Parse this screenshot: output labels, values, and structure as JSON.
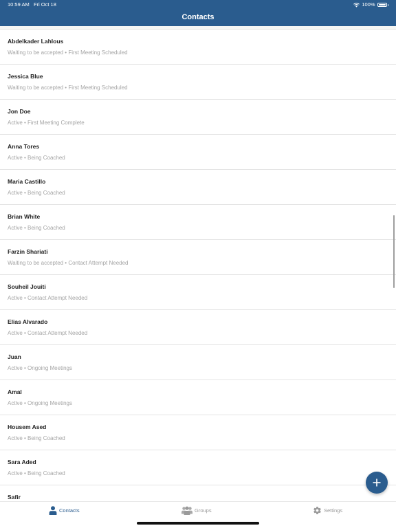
{
  "status_bar": {
    "time": "10:59 AM",
    "date": "Fri Oct 18",
    "battery": "100%"
  },
  "header": {
    "title": "Contacts"
  },
  "contacts": [
    {
      "name": "Abdelkader Lahlous",
      "status": "Waiting to be accepted • First Meeting Scheduled"
    },
    {
      "name": "Jessica Blue",
      "status": "Waiting to be accepted • First Meeting Scheduled"
    },
    {
      "name": "Jon Doe",
      "status": "Active • First Meeting Complete"
    },
    {
      "name": "Anna Tores",
      "status": "Active • Being Coached"
    },
    {
      "name": "Maria Castillo",
      "status": "Active • Being Coached"
    },
    {
      "name": "Brian White",
      "status": "Active • Being Coached"
    },
    {
      "name": "Farzin Shariati",
      "status": "Waiting to be accepted • Contact Attempt Needed"
    },
    {
      "name": "Souheil Jouiti",
      "status": "Active • Contact Attempt Needed"
    },
    {
      "name": "Elias Alvarado",
      "status": "Active • Contact Attempt Needed"
    },
    {
      "name": "Juan",
      "status": "Active • Ongoing Meetings"
    },
    {
      "name": "Amal",
      "status": "Active • Ongoing Meetings"
    },
    {
      "name": "Housem Ased",
      "status": "Active • Being Coached"
    },
    {
      "name": "Sara Aded",
      "status": "Active • Being Coached"
    },
    {
      "name": "Safir",
      "status": ""
    }
  ],
  "fab": {
    "icon": "plus-icon"
  },
  "tabbar": {
    "tabs": [
      {
        "label": "Contacts",
        "icon": "person-icon",
        "active": true
      },
      {
        "label": "Groups",
        "icon": "group-icon",
        "active": false
      },
      {
        "label": "Settings",
        "icon": "gear-icon",
        "active": false
      }
    ]
  },
  "colors": {
    "primary": "#2a5c8e",
    "inactive": "#9a9a9a",
    "subtext": "#a4a4a4"
  }
}
